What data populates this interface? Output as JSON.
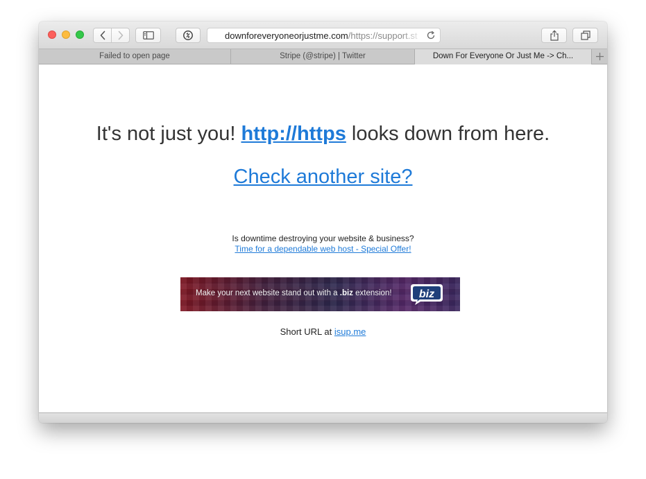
{
  "browser": {
    "address": {
      "domain": "downforeveryoneorjustme.com",
      "path": "/https://support.st"
    },
    "tabs": [
      {
        "label": "Failed to open page",
        "active": false
      },
      {
        "label": "Stripe (@stripe) | Twitter",
        "active": false
      },
      {
        "label": "Down For Everyone Or Just Me -> Ch...",
        "active": true
      }
    ],
    "new_tab_label": "+"
  },
  "page": {
    "headline_prefix": "It's not just you! ",
    "down_url": "http://https",
    "headline_suffix": " looks down from here.",
    "check_link": "Check another site?",
    "ad_question": "Is downtime destroying your website & business?",
    "ad_link": "Time for a dependable web host - Special Offer!",
    "banner": {
      "text_prefix": "Make your next website stand out with a ",
      "text_bold": ".biz",
      "text_suffix": " extension!",
      "logo_text": "biz"
    },
    "short_url_prefix": "Short URL at ",
    "short_url_link": "isup.me"
  },
  "colors": {
    "link": "#1e7ad8",
    "text": "#333333",
    "close": "#fc605c",
    "minimize": "#fdbc40",
    "maximize": "#34c84a"
  }
}
